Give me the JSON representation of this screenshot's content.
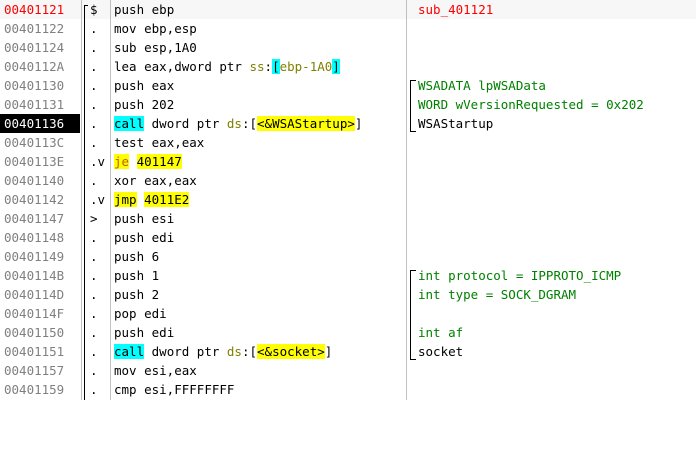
{
  "rows": [
    {
      "addr": "00401121",
      "marker": "$",
      "instr": "push ebp",
      "comment": "sub_401121"
    },
    {
      "addr": "00401122",
      "marker": ".",
      "instr": "mov ebp,esp",
      "comment": ""
    },
    {
      "addr": "00401124",
      "marker": ".",
      "instr": "sub esp,1A0",
      "comment": ""
    },
    {
      "addr": "0040112A",
      "marker": ".",
      "instr": "lea eax,dword ptr ss:[ebp-1A0]",
      "comment": ""
    },
    {
      "addr": "00401130",
      "marker": ".",
      "instr": "push eax",
      "comment": "WSADATA lpWSAData"
    },
    {
      "addr": "00401131",
      "marker": ".",
      "instr": "push 202",
      "comment": "WORD wVersionRequested = 0x202"
    },
    {
      "addr": "00401136",
      "marker": ".",
      "instr": "call dword ptr ds:[<&WSAStartup>]",
      "comment": "WSAStartup"
    },
    {
      "addr": "0040113C",
      "marker": ".",
      "instr": "test eax,eax",
      "comment": ""
    },
    {
      "addr": "0040113E",
      "marker": ".v",
      "instr": "je 401147",
      "comment": ""
    },
    {
      "addr": "00401140",
      "marker": ".",
      "instr": "xor eax,eax",
      "comment": ""
    },
    {
      "addr": "00401142",
      "marker": ".v",
      "instr": "jmp 4011E2",
      "comment": ""
    },
    {
      "addr": "00401147",
      "marker": ">",
      "instr": "push esi",
      "comment": ""
    },
    {
      "addr": "00401148",
      "marker": ".",
      "instr": "push edi",
      "comment": ""
    },
    {
      "addr": "00401149",
      "marker": ".",
      "instr": "push 6",
      "comment": ""
    },
    {
      "addr": "0040114B",
      "marker": ".",
      "instr": "push 1",
      "comment": "int protocol = IPPROTO_ICMP"
    },
    {
      "addr": "0040114D",
      "marker": ".",
      "instr": "push 2",
      "comment": "int type = SOCK_DGRAM"
    },
    {
      "addr": "0040114F",
      "marker": ".",
      "instr": "pop edi",
      "comment": ""
    },
    {
      "addr": "00401150",
      "marker": ".",
      "instr": "push edi",
      "comment": "int af"
    },
    {
      "addr": "00401151",
      "marker": ".",
      "instr": "call dword ptr ds:[<&socket>]",
      "comment": "socket"
    },
    {
      "addr": "00401157",
      "marker": ".",
      "instr": "mov esi,eax",
      "comment": ""
    },
    {
      "addr": "00401159",
      "marker": ".",
      "instr": "cmp esi,FFFFFFFF",
      "comment": ""
    }
  ],
  "parts": {
    "push": "push",
    "mov": "mov",
    "sub": "sub",
    "lea": "lea",
    "call": "call",
    "test": "test",
    "je": "je",
    "xor": "xor",
    "jmp": "jmp",
    "pop": "pop",
    "cmp": "cmp",
    "ebp": "ebp",
    "esp": "esp",
    "eax": "eax",
    "esi": "esi",
    "edi": "edi",
    "ebp_esp": "ebp,esp",
    "esp_1a0": "esp,1A0",
    "eax_comma": "eax,",
    "dword_ptr": "dword ptr ",
    "ss": "ss",
    ":": ":",
    "ds": "ds",
    "lb": "[",
    "rb": "]",
    "ebp_1a0": "ebp-1A0",
    "wsastartup_ref": "<&WSAStartup>",
    "socket_ref": "<&socket>",
    "n202": "202",
    "eax_eax": "eax,eax",
    "t401147": "401147",
    "t4011e2": "4011E2",
    "n6": "6",
    "n1": "1",
    "n2": "2",
    "esi_eax": "esi,eax",
    "esi_ff": "esi,FFFFFFFF"
  },
  "colors": {
    "current_address": "#ff0000",
    "selected_row_bg": "#000000",
    "call_highlight": "#00ffff",
    "jump_highlight": "#ffff00",
    "comment": "#008000",
    "label": "#ff0000",
    "segment": "#808000"
  }
}
